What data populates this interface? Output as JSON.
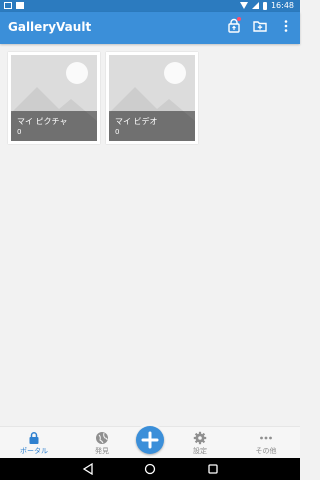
{
  "status_bar": {
    "time": "16:48"
  },
  "app_bar": {
    "title": "GalleryVault",
    "actions": [
      {
        "icon": "lock-upload-icon",
        "badge": true
      },
      {
        "icon": "add-folder-icon"
      },
      {
        "icon": "overflow-menu-icon"
      }
    ]
  },
  "albums": [
    {
      "name": "マイ ピクチャ",
      "count": "0"
    },
    {
      "name": "マイ ビデオ",
      "count": "0"
    }
  ],
  "bottom_nav": {
    "items": [
      {
        "label": "ポータル",
        "icon": "lock-icon",
        "active": true
      },
      {
        "label": "発見",
        "icon": "globe-icon",
        "active": false
      },
      {
        "label": "設定",
        "icon": "gear-icon",
        "active": false
      },
      {
        "label": "その他",
        "icon": "more-dots-icon",
        "active": false
      }
    ],
    "fab_icon": "plus-icon"
  },
  "colors": {
    "primary": "#3b8fd9",
    "status_bar": "#2c7bbf",
    "badge": "#ff4f6d",
    "active_nav": "#2e80cf"
  }
}
